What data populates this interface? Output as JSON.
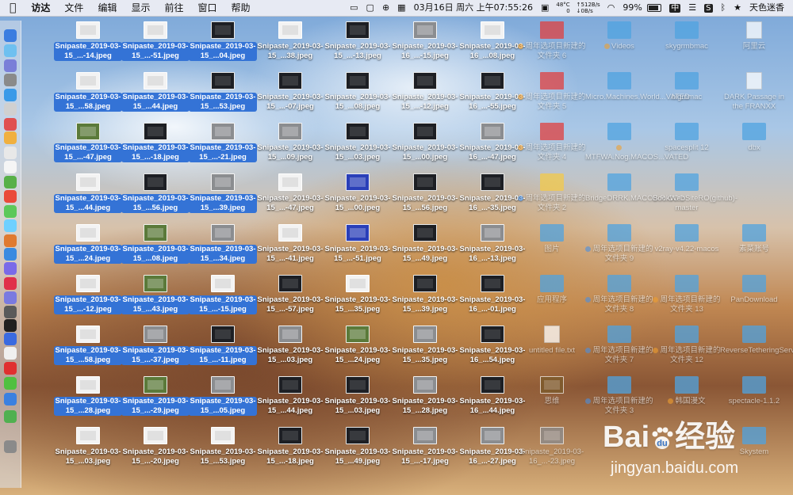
{
  "menubar": {
    "apple": "",
    "app_name": "访达",
    "menus": [
      "文件",
      "编辑",
      "显示",
      "前往",
      "窗口",
      "帮助"
    ],
    "temp_top": "48°C",
    "temp_bottom": "0",
    "net_up": "↑512B/s",
    "net_down": "↓0B/s",
    "datetime": "03月16日 周六 上午07:55:26",
    "battery": "99%",
    "ime": "中",
    "user": "天色迷香"
  },
  "icons": {
    "snipaste": [
      "Snipaste_2019-03-15_...-14.jpeg",
      "Snipaste_2019-03-15_...-51.jpeg",
      "Snipaste_2019-03-15_...04.jpeg",
      "Snipaste_2019-03-15_...38.jpeg",
      "Snipaste_2019-03-15_...-13.jpeg",
      "Snipaste_2019-03-16_...-15.jpeg",
      "Snipaste_2019-03-16_...08.jpeg",
      "Snipaste_2019-03-15_...58.jpeg",
      "Snipaste_2019-03-15_...44.jpeg",
      "Snipaste_2019-03-15_...53.jpeg",
      "Snipaste_2019-03-15_...-07.jpeg",
      "Snipaste_2019-03-15_...08.jpeg",
      "Snipaste_2019-03-15_...-12.jpeg",
      "Snipaste_2019-03-16_...-55.jpeg",
      "Snipaste_2019-03-15_...-47.jpeg",
      "Snipaste_2019-03-15_...-18.jpeg",
      "Snipaste_2019-03-15_...-21.jpeg",
      "Snipaste_2019-03-15_...09.jpeg",
      "Snipaste_2019-03-15_...03.jpeg",
      "Snipaste_2019-03-15_...00.jpeg",
      "Snipaste_2019-03-16_...-47.jpeg",
      "Snipaste_2019-03-15_...44.jpeg",
      "Snipaste_2019-03-15_...56.jpeg",
      "Snipaste_2019-03-15_...39.jpeg",
      "Snipaste_2019-03-15_...-47.jpeg",
      "Snipaste_2019-03-15_...00.jpeg",
      "Snipaste_2019-03-15_...56.jpeg",
      "Snipaste_2019-03-16_...-35.jpeg",
      "Snipaste_2019-03-15_...24.jpeg",
      "Snipaste_2019-03-15_...08.jpeg",
      "Snipaste_2019-03-15_...34.jpeg",
      "Snipaste_2019-03-15_...-41.jpeg",
      "Snipaste_2019-03-15_...-51.jpeg",
      "Snipaste_2019-03-15_...49.jpeg",
      "Snipaste_2019-03-16_...-13.jpeg",
      "Snipaste_2019-03-15_...-12.jpeg",
      "Snipaste_2019-03-15_...43.jpeg",
      "Snipaste_2019-03-15_...-15.jpeg",
      "Snipaste_2019-03-15_...-57.jpeg",
      "Snipaste_2019-03-15_...35.jpeg",
      "Snipaste_2019-03-15_...39.jpeg",
      "Snipaste_2019-03-16_...-01.jpeg",
      "Snipaste_2019-03-15_...58.jpeg",
      "Snipaste_2019-03-15_...-37.jpeg",
      "Snipaste_2019-03-15_...-11.jpeg",
      "Snipaste_2019-03-15_...03.jpeg",
      "Snipaste_2019-03-15_...24.jpeg",
      "Snipaste_2019-03-15_...35.jpeg",
      "Snipaste_2019-03-16_...54.jpeg",
      "Snipaste_2019-03-15_...28.jpeg",
      "Snipaste_2019-03-15_...-29.jpeg",
      "Snipaste_2019-03-15_...05.jpeg",
      "Snipaste_2019-03-15_...44.jpeg",
      "Snipaste_2019-03-15_...03.jpeg",
      "Snipaste_2019-03-15_...28.jpeg",
      "Snipaste_2019-03-16_...44.jpeg",
      "Snipaste_2019-03-15_...03.jpeg",
      "Snipaste_2019-03-15_...-20.jpeg",
      "Snipaste_2019-03-15_...53.jpeg",
      "Snipaste_2019-03-15_...-18.jpeg",
      "Snipaste_2019-03-15_...49.jpeg",
      "Snipaste_2019-03-15_...-17.jpeg",
      "Snipaste_2019-03-16_...-27.jpeg"
    ],
    "right_items": [
      {
        "label": "周年选项目新建的文件夹 6",
        "tag": "#f0a030",
        "kind": "redbox"
      },
      {
        "label": "Videos",
        "tag": "#f0a030",
        "kind": "folder"
      },
      {
        "label": "skygrmbmac",
        "tag": "",
        "kind": "folder"
      },
      {
        "label": "阿里云",
        "tag": "",
        "kind": "doc"
      },
      {
        "label": "周年选项目新建的文件夹 5",
        "tag": "#f0a030",
        "kind": "redbox"
      },
      {
        "label": "Micro.Machines.World...VATED",
        "tag": "",
        "kind": "folder"
      },
      {
        "label": "bigmmac",
        "tag": "",
        "kind": "folder"
      },
      {
        "label": "DARK Passage in the FRANXX",
        "tag": "",
        "kind": "doc"
      },
      {
        "label": "周年选项目新建的文件夹 4",
        "tag": "#f0a030",
        "kind": "redbox"
      },
      {
        "label": "MTFWA.Nog.MACOS...VATED",
        "tag": "#f0a030",
        "kind": "folder"
      },
      {
        "label": "spacesplit 12",
        "tag": "",
        "kind": "folder"
      },
      {
        "label": "dbx",
        "tag": "",
        "kind": "folder"
      },
      {
        "label": "周年选项目新建的文件夹 2",
        "tag": "#4a90e2",
        "kind": "folder-y"
      },
      {
        "label": "BridgeDRRK.MACOS.R.COO",
        "tag": "",
        "kind": "folder"
      },
      {
        "label": "BookWebSiteRO(github)-master",
        "tag": "",
        "kind": "folder"
      },
      {
        "label": "",
        "tag": "",
        "kind": "none"
      },
      {
        "label": "图片",
        "tag": "",
        "kind": "folder"
      },
      {
        "label": "周年选项目新建的文件夹 9",
        "tag": "#4a90e2",
        "kind": "folder"
      },
      {
        "label": "v2ray-v4.22-macos",
        "tag": "",
        "kind": "folder"
      },
      {
        "label": "素菜账号",
        "tag": "",
        "kind": "folder"
      },
      {
        "label": "应用程序",
        "tag": "",
        "kind": "app"
      },
      {
        "label": "周年选项目新建的文件夹 8",
        "tag": "#4a90e2",
        "kind": "folder"
      },
      {
        "label": "周年选项目新建的文件夹 13",
        "tag": "#f0a030",
        "kind": "folder"
      },
      {
        "label": "PanDownload",
        "tag": "",
        "kind": "folder"
      },
      {
        "label": "untitled file.txt",
        "tag": "",
        "kind": "doc"
      },
      {
        "label": "周年选项目新建的文件夹 7",
        "tag": "#4a90e2",
        "kind": "folder"
      },
      {
        "label": "周年选项目新建的文件夹 12",
        "tag": "#f0a030",
        "kind": "folder"
      },
      {
        "label": "ReverseTetheringServer_1.2.0",
        "tag": "",
        "kind": "folder"
      },
      {
        "label": "思维",
        "tag": "",
        "kind": "brown"
      },
      {
        "label": "周年选项目新建的文件夹 3",
        "tag": "#4a90e2",
        "kind": "folder"
      },
      {
        "label": "韩国漫文",
        "tag": "#f0a030",
        "kind": "folder"
      },
      {
        "label": "spectacle-1.1.2",
        "tag": "",
        "kind": "folder"
      },
      {
        "label": "Snipaste_2019-03-16_...-23.jpeg",
        "tag": "",
        "kind": "img"
      },
      {
        "label": "",
        "tag": "",
        "kind": "none"
      },
      {
        "label": "",
        "tag": "",
        "kind": "none"
      },
      {
        "label": "Skystem",
        "tag": "",
        "kind": "folder"
      }
    ]
  },
  "watermark": {
    "logo_left": "Bai",
    "logo_right": "经验",
    "url": "jingyan.baidu.com"
  }
}
